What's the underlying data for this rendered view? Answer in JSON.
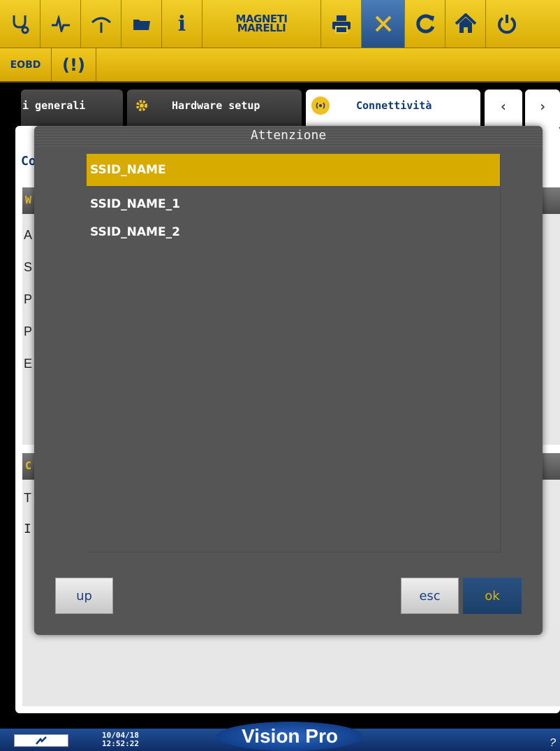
{
  "toolbar": {
    "brand_line1": "MAGNETI",
    "brand_line2": "MARELLI",
    "info_glyph": "i",
    "icons": [
      "diagnosis-icon",
      "oscilloscope-icon",
      "gauge-icon",
      "folder-icon",
      "info-icon",
      "brand-logo",
      "printer-icon",
      "tools-icon",
      "sync-icon",
      "home-icon",
      "power-icon"
    ]
  },
  "subbar": {
    "eobd_label": "EOBD",
    "warning_label": "(!)"
  },
  "tabs": [
    {
      "label": "i generali"
    },
    {
      "label": "Hardware setup",
      "icon": "gear-icon"
    },
    {
      "label": "Connettività",
      "icon": "wifi-icon"
    }
  ],
  "background": {
    "title_fragment": "Co",
    "section1_fragment": "W",
    "rows": [
      "A",
      "S",
      "P",
      "P",
      "E"
    ],
    "section2_fragment": "C",
    "rows2": [
      "T",
      "I"
    ]
  },
  "dialog": {
    "title": "Attenzione",
    "items": [
      {
        "label": "SSID_NAME",
        "selected": true
      },
      {
        "label": "SSID_NAME_1",
        "selected": false
      },
      {
        "label": "SSID_NAME_2",
        "selected": false
      }
    ],
    "up_label": "up",
    "esc_label": "esc",
    "ok_label": "ok"
  },
  "status": {
    "date": "10/04/18",
    "time": "12:52:22",
    "product": "Vision Pro",
    "right_glyph": "?"
  },
  "colors": {
    "toolbar_yellow": "#f2cf2a",
    "active_blue": "#245088",
    "selection_gold": "#d7ab00",
    "dialog_gray": "#555555",
    "navy": "#123a72"
  }
}
